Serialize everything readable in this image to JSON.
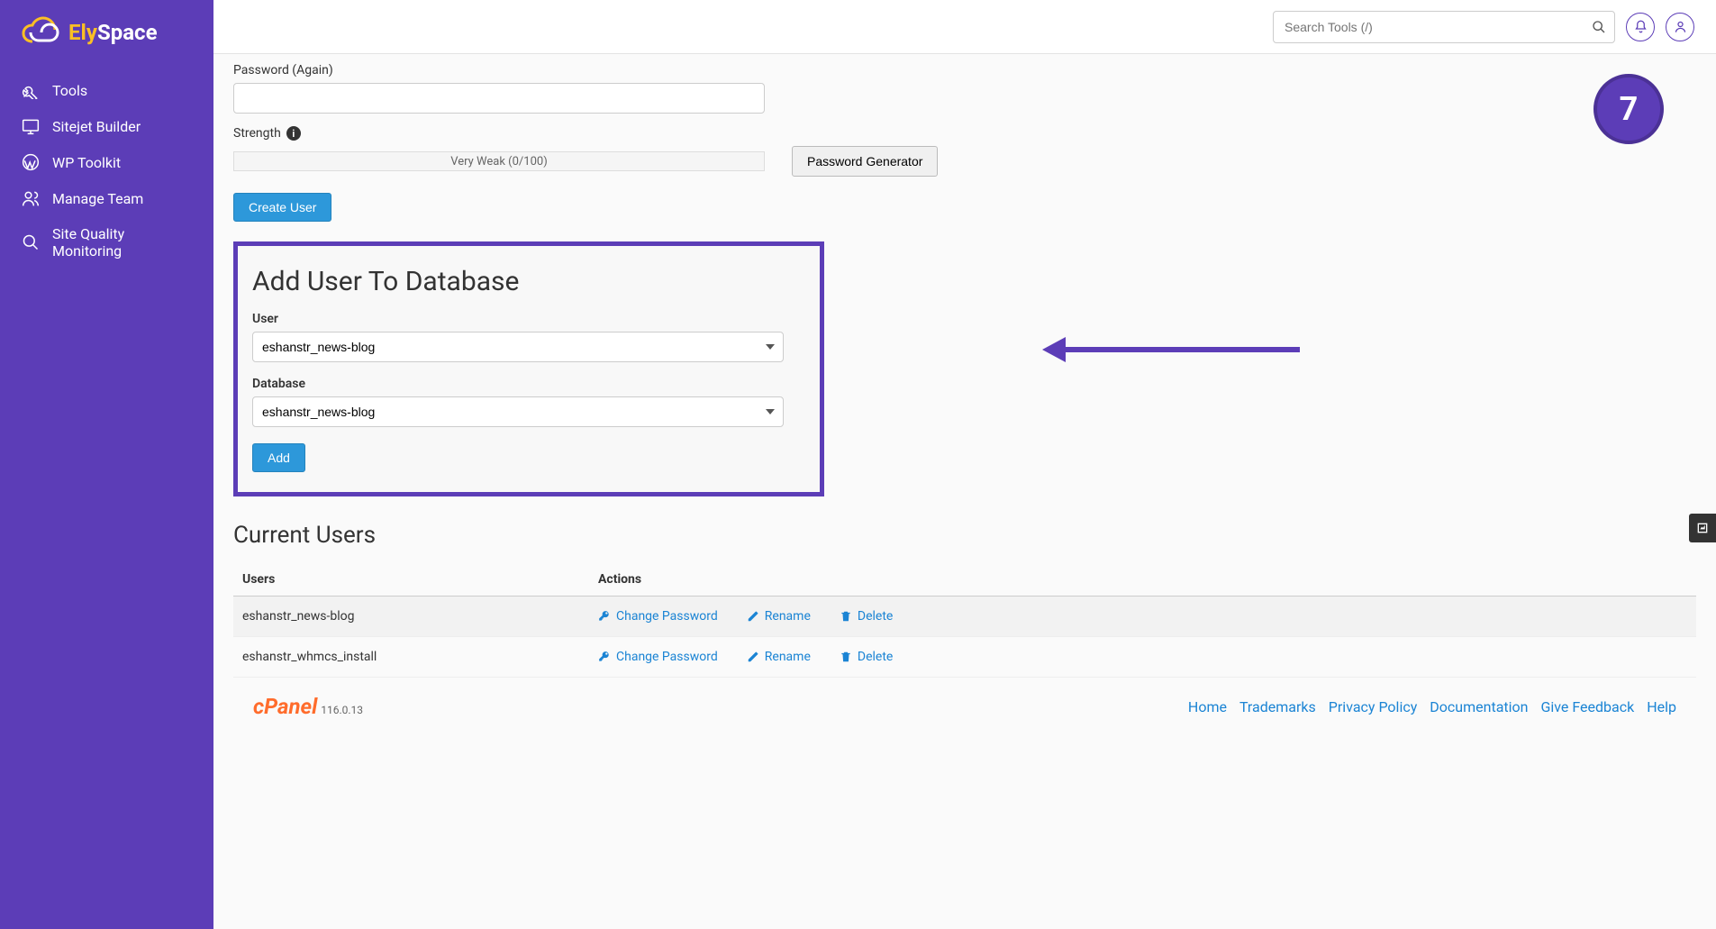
{
  "brand": {
    "name_a": "Ely",
    "name_b": "Space"
  },
  "sidebar": {
    "items": [
      {
        "label": "Tools"
      },
      {
        "label": "Sitejet Builder"
      },
      {
        "label": "WP Toolkit"
      },
      {
        "label": "Manage Team"
      },
      {
        "label": "Site Quality Monitoring"
      }
    ]
  },
  "header": {
    "search_placeholder": "Search Tools (/)"
  },
  "step_badge": "7",
  "form": {
    "password_again_label": "Password (Again)",
    "strength_label": "Strength",
    "strength_text": "Very Weak (0/100)",
    "pwd_gen_label": "Password Generator",
    "create_user_label": "Create User"
  },
  "add_user_section": {
    "title": "Add User To Database",
    "user_label": "User",
    "user_value": "eshanstr_news-blog",
    "db_label": "Database",
    "db_value": "eshanstr_news-blog",
    "add_label": "Add"
  },
  "current_users": {
    "title": "Current Users",
    "col_users": "Users",
    "col_actions": "Actions",
    "change_pwd": "Change Password",
    "rename": "Rename",
    "delete": "Delete",
    "rows": [
      {
        "user": "eshanstr_news-blog"
      },
      {
        "user": "eshanstr_whmcs_install"
      }
    ]
  },
  "footer": {
    "cpanel": "cPanel",
    "version": "116.0.13",
    "links": [
      "Home",
      "Trademarks",
      "Privacy Policy",
      "Documentation",
      "Give Feedback",
      "Help"
    ]
  }
}
